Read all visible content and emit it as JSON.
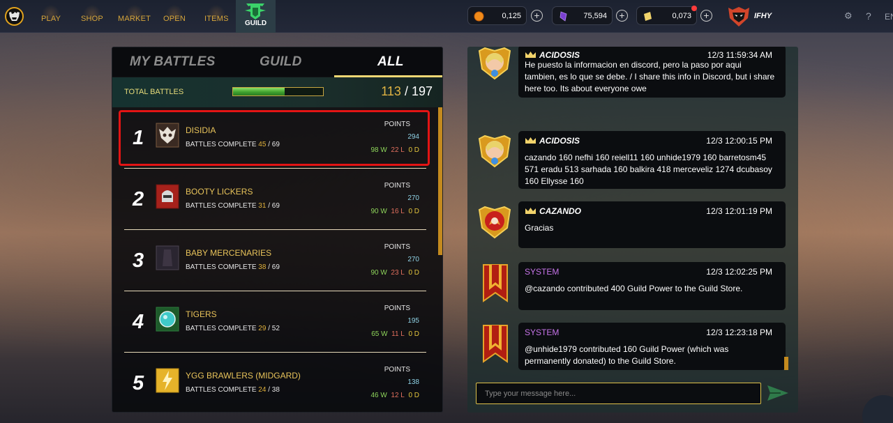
{
  "topbar": {
    "nav": [
      {
        "id": "play",
        "label": "PLAY"
      },
      {
        "id": "shop",
        "label": "SHOP"
      },
      {
        "id": "market",
        "label": "MARKET"
      },
      {
        "id": "open",
        "label": "OPEN"
      },
      {
        "id": "items",
        "label": "ITEMS"
      }
    ],
    "guild_label": "GUILD",
    "currencies": [
      {
        "name": "credits",
        "icon": "coin-icon",
        "value": "0,125",
        "color": "#f08b1a"
      },
      {
        "name": "dark-energy-crystals",
        "icon": "crystal-icon",
        "value": "75,594",
        "color": "#7a3fd1"
      },
      {
        "name": "voucher",
        "icon": "voucher-icon",
        "value": "0,073",
        "color": "#f1d36b"
      }
    ],
    "username": "IFHY",
    "extra_label": "EN"
  },
  "battles": {
    "tabs": [
      {
        "label": "MY BATTLES",
        "active": false
      },
      {
        "label": "GUILD",
        "active": false
      },
      {
        "label": "ALL",
        "active": true
      }
    ],
    "total_label": "TOTAL BATTLES",
    "progress_fraction": 0.57,
    "total_current": "113",
    "total_sep": " / ",
    "total_max": "197",
    "points_label": "POINTS",
    "battles_complete_label": "BATTLES COMPLETE",
    "rows": [
      {
        "rank": "1",
        "name": "DISIDIA",
        "complete": "45",
        "of": "69",
        "points": "294",
        "wins": "98 W",
        "losses": "22 L",
        "draws": "0 D",
        "emblem": "skull-emblem-icon"
      },
      {
        "rank": "2",
        "name": "BOOTY LICKERS",
        "complete": "31",
        "of": "69",
        "points": "270",
        "wins": "90 W",
        "losses": "16 L",
        "draws": "0 D",
        "emblem": "helmet-emblem-icon"
      },
      {
        "rank": "3",
        "name": "BABY MERCENARIES",
        "complete": "38",
        "of": "69",
        "points": "270",
        "wins": "90 W",
        "losses": "23 L",
        "draws": "0 D",
        "emblem": "dark-emblem-icon"
      },
      {
        "rank": "4",
        "name": "TIGERS",
        "complete": "29",
        "of": "52",
        "points": "195",
        "wins": "65 W",
        "losses": "11 L",
        "draws": "0 D",
        "emblem": "orb-emblem-icon"
      },
      {
        "rank": "5",
        "name": "YGG BRAWLERS (MIDGARD)",
        "complete": "24",
        "of": "38",
        "points": "138",
        "wins": "46 W",
        "losses": "12 L",
        "draws": "0 D",
        "emblem": "lightning-emblem-icon"
      }
    ]
  },
  "chat": {
    "messages": [
      {
        "author": "ACIDOSIS",
        "system": false,
        "time": "12/3 11:59:34 AM",
        "avatar": "elf-avatar-icon",
        "text": "He puesto la informacion en discord, pero la paso por aqui tambien, es lo que se debe. / I share this info in Discord, but i share here too. Its about everyone owe"
      },
      {
        "author": "ACIDOSIS",
        "system": false,
        "time": "12/3 12:00:15 PM",
        "avatar": "elf-avatar-icon",
        "text": "cazando 160 nefhi 160 reiell11 160 unhide1979 160 barretosm45 571 eradu 513 sarhada 160 balkira 418 merceveliz 1274 dcubasoy 160 Ellysse 160"
      },
      {
        "author": "CAZANDO",
        "system": false,
        "time": "12/3 12:01:19 PM",
        "avatar": "fire-avatar-icon",
        "text": "Gracias"
      },
      {
        "author": "SYSTEM",
        "system": true,
        "time": "12/3 12:02:25 PM",
        "avatar": "banner-icon",
        "text": "@cazando contributed 400 Guild Power to the Guild Store."
      },
      {
        "author": "SYSTEM",
        "system": true,
        "time": "12/3 12:23:18 PM",
        "avatar": "banner-icon",
        "text": "@unhide1979 contributed 160 Guild Power (which was permanently donated) to the Guild Store."
      }
    ],
    "input_placeholder": "Type your message here..."
  }
}
